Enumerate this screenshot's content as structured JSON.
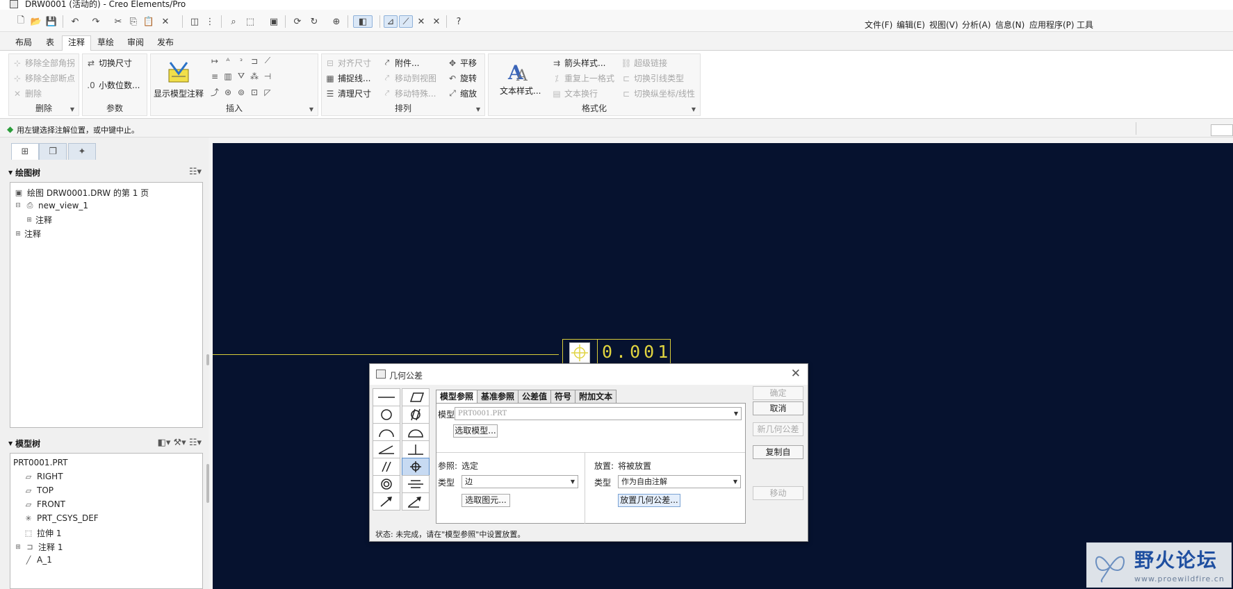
{
  "window": {
    "title": "DRW0001 (活动的) - Creo Elements/Pro"
  },
  "menubar": [
    "文件(F)",
    "编辑(E)",
    "视图(V)",
    "分析(A)",
    "信息(N)",
    "应用程序(P)",
    "工具"
  ],
  "ribbon_tabs": [
    "布局",
    "表",
    "注释",
    "草绘",
    "审阅",
    "发布"
  ],
  "ribbon": {
    "delete": {
      "label": "删除",
      "items": [
        "移除全部角拐",
        "移除全部断点",
        "删除"
      ]
    },
    "params": {
      "label": "参数",
      "items": [
        "切换尺寸",
        "小数位数..."
      ]
    },
    "insert": {
      "label": "插入",
      "big": "显示模型注释"
    },
    "arrange": {
      "label": "排列",
      "items": [
        "对齐尺寸",
        "捕捉线...",
        "清理尺寸",
        "附件...",
        "移动到视图",
        "移动特殊...",
        "平移",
        "旋转",
        "缩放"
      ]
    },
    "format": {
      "label": "格式化",
      "big": "文本样式...",
      "items": [
        "箭头样式...",
        "重复上一格式",
        "文本换行",
        "超级链接",
        "切换引线类型",
        "切换纵坐标/线性"
      ]
    }
  },
  "prompt": "用左键选择注解位置，或中键中止。",
  "drawing_tree": {
    "title": "绘图树",
    "items": [
      "绘图 DRW0001.DRW 的第 1 页",
      "new_view_1",
      "注释",
      "注释"
    ]
  },
  "model_tree": {
    "title": "模型树",
    "items": [
      "PRT0001.PRT",
      "RIGHT",
      "TOP",
      "FRONT",
      "PRT_CSYS_DEF",
      "拉伸 1",
      "注释 1",
      "A_1"
    ]
  },
  "graphics": {
    "tolerance_value": "0.001"
  },
  "dialog": {
    "title": "几何公差",
    "tabs": [
      "模型参照",
      "基准参照",
      "公差值",
      "符号",
      "附加文本"
    ],
    "model_label": "模型",
    "model_value": "PRT0001.PRT",
    "select_model": "选取模型...",
    "ref_label": "参照:",
    "ref_value": "选定",
    "type_label": "类型",
    "ref_type": "边",
    "select_entity": "选取图元...",
    "place_label": "放置:",
    "place_value": "将被放置",
    "place_type": "作为自由注解",
    "place_button": "放置几何公差...",
    "right_buttons": [
      "确定",
      "取消",
      "新几何公差",
      "复制自",
      "移动"
    ],
    "status": "状态: 未完成，请在\"模型参照\"中设置放置。"
  },
  "watermark": {
    "name": "野火论坛",
    "url": "www.proewildfire.cn"
  }
}
